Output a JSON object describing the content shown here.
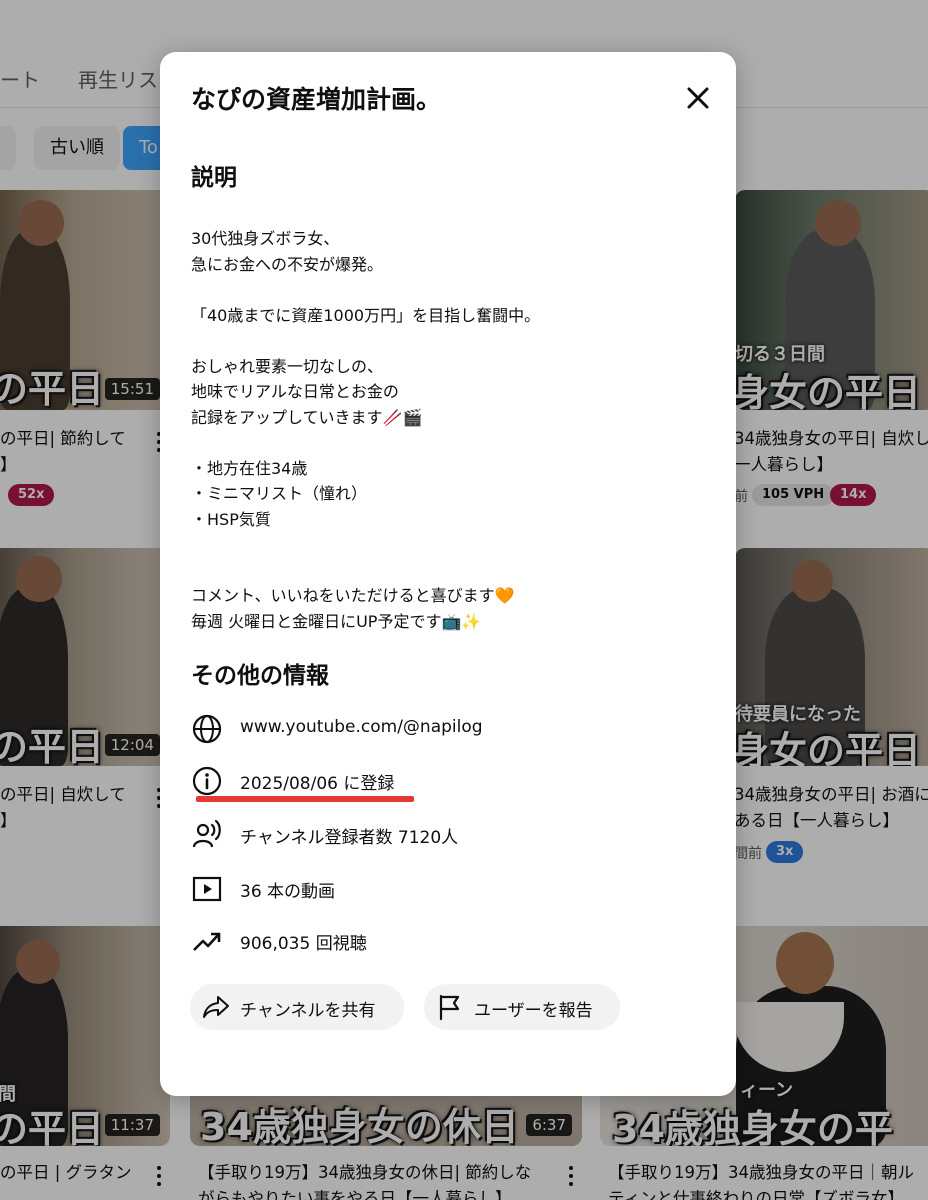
{
  "background": {
    "tabs": [
      "ート",
      "再生リス"
    ],
    "chips": [
      {
        "label": "",
        "active": false
      },
      {
        "label": "古い順",
        "active": false
      },
      {
        "label": "To",
        "active": true
      }
    ],
    "videos": [
      {
        "caption": "の平日",
        "duration": "15:51",
        "title1": "の平日| 節約して",
        "title2": "",
        "badges": [
          {
            "text": "52x",
            "style": "red"
          }
        ]
      },
      {
        "caption": "身女の平日",
        "subcaption": "切る３日間",
        "duration": "",
        "title1": "34歳独身女の平日| 自炊し",
        "title2": "一人暮らし】",
        "meta": "前",
        "badges": [
          {
            "text": "105 VPH",
            "style": "gray"
          },
          {
            "text": "14x",
            "style": "red"
          }
        ]
      },
      {
        "caption": "の平日",
        "duration": "12:04",
        "title1": "の平日| 自炊して",
        "title2": "",
        "badges": []
      },
      {
        "caption": "身女の平日",
        "subcaption": "待要員になった",
        "duration": "",
        "title1": "34歳独身女の平日| お酒に",
        "title2": "ある日【一人暮らし】",
        "meta": "間前",
        "badges": [
          {
            "text": "3x",
            "style": "blue"
          }
        ]
      },
      {
        "caption": "の平日",
        "subcaption": "間",
        "duration": "11:37",
        "title1": "の平日 | グラタン",
        "title2": "",
        "badges": []
      },
      {
        "caption": "34歳独身女の休日",
        "duration": "6:37",
        "title1": "【手取り19万】34歳独身女の休日| 節約しな",
        "title2": "がらもやりたい事をやる日【一人暮らし】",
        "badges": []
      },
      {
        "caption": "34歳独身女の平",
        "subcaption": "ィーン",
        "duration": "",
        "title1": "【手取り19万】34歳独身女の平日｜朝ル",
        "title2": "ティンと仕事終わりの日常【ズボラ女】",
        "badges": []
      }
    ]
  },
  "modal": {
    "title": "なぴの資産増加計画。",
    "description_heading": "説明",
    "description": "30代独身ズボラ女、\n急にお金への不安が爆発。\n\n「40歳までに資産1000万円」を目指し奮闘中。\n\nおしゃれ要素一切なしの、\n地味でリアルな日常とお金の\n記録をアップしていきます🥢🎬\n\n・地方在住34歳\n・ミニマリスト（憧れ）\n・HSP気質\n\n\nコメント、いいねをいただけると喜びます🧡\n毎週 火曜日と金曜日にUP予定です📺✨",
    "other_info_heading": "その他の情報",
    "info": {
      "url": "www.youtube.com/@napilog",
      "joined": "2025/08/06 に登録",
      "subscribers": "チャンネル登録者数 7120人",
      "videos": "36 本の動画",
      "views": "906,035 回視聴"
    },
    "actions": {
      "share": "チャンネルを共有",
      "report": "ユーザーを報告"
    },
    "annotation_color": "#e53935"
  },
  "icons": [
    "close-icon",
    "globe-icon",
    "info-icon",
    "subscribers-icon",
    "video-icon",
    "trending-up-icon",
    "share-icon",
    "flag-icon"
  ]
}
